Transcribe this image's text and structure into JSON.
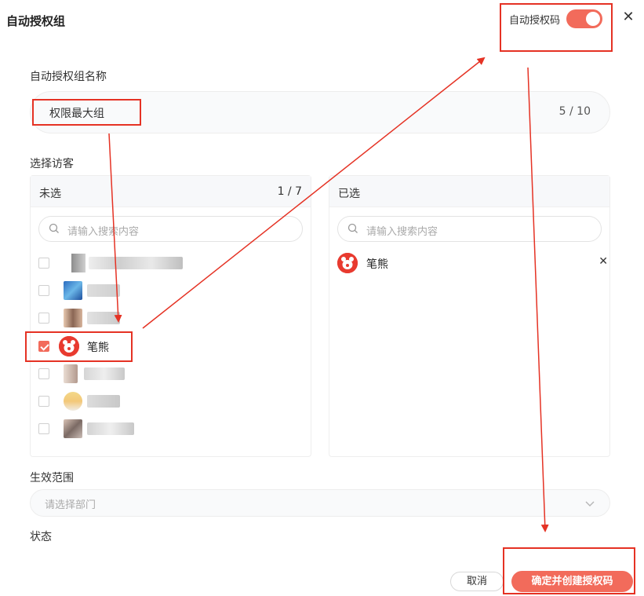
{
  "dialog": {
    "title": "自动授权组"
  },
  "auto_code": {
    "label": "自动授权码",
    "enabled": true
  },
  "name_field": {
    "label": "自动授权组名称",
    "value": "权限最大组",
    "char_count": "5 / 10"
  },
  "visitors": {
    "label": "选择访客",
    "unselected": {
      "title": "未选",
      "count": "1 / 7",
      "search_placeholder": "请输入搜索内容",
      "items": [
        {
          "name": "",
          "checked": false,
          "blurred": true
        },
        {
          "name": "",
          "checked": false,
          "blurred": true
        },
        {
          "name": "",
          "checked": false,
          "blurred": true
        },
        {
          "name": "笔熊",
          "checked": true,
          "blurred": false
        },
        {
          "name": "",
          "checked": false,
          "blurred": true
        },
        {
          "name": "",
          "checked": false,
          "blurred": true
        },
        {
          "name": "",
          "checked": false,
          "blurred": true
        }
      ]
    },
    "selected": {
      "title": "已选",
      "search_placeholder": "请输入搜索内容",
      "items": [
        {
          "name": "笔熊"
        }
      ]
    }
  },
  "scope": {
    "label": "生效范围",
    "placeholder": "请选择部门"
  },
  "status": {
    "label": "状态"
  },
  "actions": {
    "cancel": "取消",
    "confirm": "确定并创建授权码"
  },
  "colors": {
    "accent": "#f26b5b",
    "annotation_red": "#e53224",
    "brand_avatar": "#e83a2f"
  }
}
